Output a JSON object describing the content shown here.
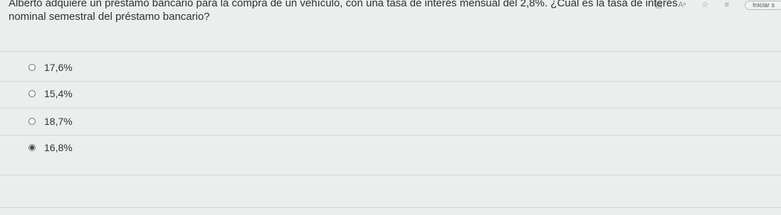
{
  "toolbar": {
    "icons": [
      "book-icon",
      "text-size-icon",
      "star-icon",
      "list-icon"
    ],
    "start_label": "Iniciar s"
  },
  "question": {
    "line1": "Alberto adquiere un préstamo bancario para la compra de un vehículo, con una tasa de interés mensual del 2,8%. ¿Cuál es la tasa de interés",
    "line2": "nominal semestral del préstamo bancario?"
  },
  "options": [
    {
      "label": "17,6%",
      "selected": false
    },
    {
      "label": "15,4%",
      "selected": false
    },
    {
      "label": "18,7%",
      "selected": false
    },
    {
      "label": "16,8%",
      "selected": true
    }
  ]
}
